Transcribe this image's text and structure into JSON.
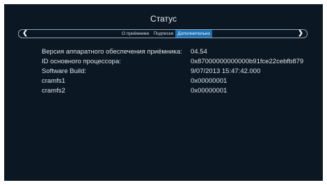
{
  "header": {
    "title": "Статус"
  },
  "tabs": [
    {
      "label": "О приёмнике",
      "active": false
    },
    {
      "label": "Подписки",
      "active": false
    },
    {
      "label": "Дополнительно",
      "active": true
    }
  ],
  "icons": {
    "left": "chevron-left-icon",
    "right": "chevron-right-icon"
  },
  "rows": [
    {
      "label": "Версия аппаратного обеспечения приёмника:",
      "value": "04.54"
    },
    {
      "label": "ID основного процессора:",
      "value": "0x87000000000000b91fce22cebfb879"
    },
    {
      "label": "Software Build:",
      "value": "9/07/2013 15:47:42.000"
    },
    {
      "label": "cramfs1",
      "value": "0x00000001"
    },
    {
      "label": "cramfs2",
      "value": "0x00000001"
    }
  ],
  "colors": {
    "background": "#0b1722",
    "active_tab": "#1b6fb3",
    "text": "#dde4eb"
  }
}
